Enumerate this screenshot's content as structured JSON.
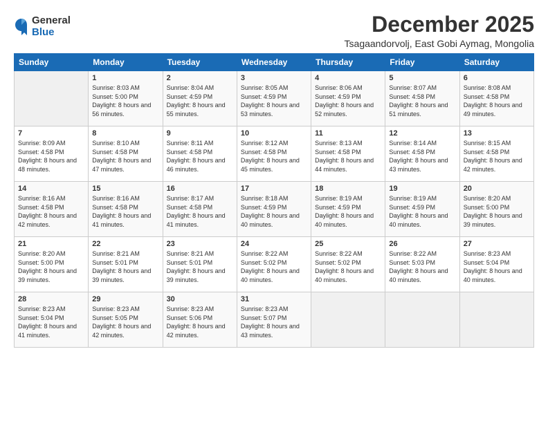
{
  "logo": {
    "general": "General",
    "blue": "Blue"
  },
  "title": "December 2025",
  "location": "Tsagaandorvolj, East Gobi Aymag, Mongolia",
  "days_of_week": [
    "Sunday",
    "Monday",
    "Tuesday",
    "Wednesday",
    "Thursday",
    "Friday",
    "Saturday"
  ],
  "weeks": [
    [
      {
        "day": "",
        "sunrise": "",
        "sunset": "",
        "daylight": ""
      },
      {
        "day": "1",
        "sunrise": "Sunrise: 8:03 AM",
        "sunset": "Sunset: 5:00 PM",
        "daylight": "Daylight: 8 hours and 56 minutes."
      },
      {
        "day": "2",
        "sunrise": "Sunrise: 8:04 AM",
        "sunset": "Sunset: 4:59 PM",
        "daylight": "Daylight: 8 hours and 55 minutes."
      },
      {
        "day": "3",
        "sunrise": "Sunrise: 8:05 AM",
        "sunset": "Sunset: 4:59 PM",
        "daylight": "Daylight: 8 hours and 53 minutes."
      },
      {
        "day": "4",
        "sunrise": "Sunrise: 8:06 AM",
        "sunset": "Sunset: 4:59 PM",
        "daylight": "Daylight: 8 hours and 52 minutes."
      },
      {
        "day": "5",
        "sunrise": "Sunrise: 8:07 AM",
        "sunset": "Sunset: 4:58 PM",
        "daylight": "Daylight: 8 hours and 51 minutes."
      },
      {
        "day": "6",
        "sunrise": "Sunrise: 8:08 AM",
        "sunset": "Sunset: 4:58 PM",
        "daylight": "Daylight: 8 hours and 49 minutes."
      }
    ],
    [
      {
        "day": "7",
        "sunrise": "Sunrise: 8:09 AM",
        "sunset": "Sunset: 4:58 PM",
        "daylight": "Daylight: 8 hours and 48 minutes."
      },
      {
        "day": "8",
        "sunrise": "Sunrise: 8:10 AM",
        "sunset": "Sunset: 4:58 PM",
        "daylight": "Daylight: 8 hours and 47 minutes."
      },
      {
        "day": "9",
        "sunrise": "Sunrise: 8:11 AM",
        "sunset": "Sunset: 4:58 PM",
        "daylight": "Daylight: 8 hours and 46 minutes."
      },
      {
        "day": "10",
        "sunrise": "Sunrise: 8:12 AM",
        "sunset": "Sunset: 4:58 PM",
        "daylight": "Daylight: 8 hours and 45 minutes."
      },
      {
        "day": "11",
        "sunrise": "Sunrise: 8:13 AM",
        "sunset": "Sunset: 4:58 PM",
        "daylight": "Daylight: 8 hours and 44 minutes."
      },
      {
        "day": "12",
        "sunrise": "Sunrise: 8:14 AM",
        "sunset": "Sunset: 4:58 PM",
        "daylight": "Daylight: 8 hours and 43 minutes."
      },
      {
        "day": "13",
        "sunrise": "Sunrise: 8:15 AM",
        "sunset": "Sunset: 4:58 PM",
        "daylight": "Daylight: 8 hours and 42 minutes."
      }
    ],
    [
      {
        "day": "14",
        "sunrise": "Sunrise: 8:16 AM",
        "sunset": "Sunset: 4:58 PM",
        "daylight": "Daylight: 8 hours and 42 minutes."
      },
      {
        "day": "15",
        "sunrise": "Sunrise: 8:16 AM",
        "sunset": "Sunset: 4:58 PM",
        "daylight": "Daylight: 8 hours and 41 minutes."
      },
      {
        "day": "16",
        "sunrise": "Sunrise: 8:17 AM",
        "sunset": "Sunset: 4:58 PM",
        "daylight": "Daylight: 8 hours and 41 minutes."
      },
      {
        "day": "17",
        "sunrise": "Sunrise: 8:18 AM",
        "sunset": "Sunset: 4:59 PM",
        "daylight": "Daylight: 8 hours and 40 minutes."
      },
      {
        "day": "18",
        "sunrise": "Sunrise: 8:19 AM",
        "sunset": "Sunset: 4:59 PM",
        "daylight": "Daylight: 8 hours and 40 minutes."
      },
      {
        "day": "19",
        "sunrise": "Sunrise: 8:19 AM",
        "sunset": "Sunset: 4:59 PM",
        "daylight": "Daylight: 8 hours and 40 minutes."
      },
      {
        "day": "20",
        "sunrise": "Sunrise: 8:20 AM",
        "sunset": "Sunset: 5:00 PM",
        "daylight": "Daylight: 8 hours and 39 minutes."
      }
    ],
    [
      {
        "day": "21",
        "sunrise": "Sunrise: 8:20 AM",
        "sunset": "Sunset: 5:00 PM",
        "daylight": "Daylight: 8 hours and 39 minutes."
      },
      {
        "day": "22",
        "sunrise": "Sunrise: 8:21 AM",
        "sunset": "Sunset: 5:01 PM",
        "daylight": "Daylight: 8 hours and 39 minutes."
      },
      {
        "day": "23",
        "sunrise": "Sunrise: 8:21 AM",
        "sunset": "Sunset: 5:01 PM",
        "daylight": "Daylight: 8 hours and 39 minutes."
      },
      {
        "day": "24",
        "sunrise": "Sunrise: 8:22 AM",
        "sunset": "Sunset: 5:02 PM",
        "daylight": "Daylight: 8 hours and 40 minutes."
      },
      {
        "day": "25",
        "sunrise": "Sunrise: 8:22 AM",
        "sunset": "Sunset: 5:02 PM",
        "daylight": "Daylight: 8 hours and 40 minutes."
      },
      {
        "day": "26",
        "sunrise": "Sunrise: 8:22 AM",
        "sunset": "Sunset: 5:03 PM",
        "daylight": "Daylight: 8 hours and 40 minutes."
      },
      {
        "day": "27",
        "sunrise": "Sunrise: 8:23 AM",
        "sunset": "Sunset: 5:04 PM",
        "daylight": "Daylight: 8 hours and 40 minutes."
      }
    ],
    [
      {
        "day": "28",
        "sunrise": "Sunrise: 8:23 AM",
        "sunset": "Sunset: 5:04 PM",
        "daylight": "Daylight: 8 hours and 41 minutes."
      },
      {
        "day": "29",
        "sunrise": "Sunrise: 8:23 AM",
        "sunset": "Sunset: 5:05 PM",
        "daylight": "Daylight: 8 hours and 42 minutes."
      },
      {
        "day": "30",
        "sunrise": "Sunrise: 8:23 AM",
        "sunset": "Sunset: 5:06 PM",
        "daylight": "Daylight: 8 hours and 42 minutes."
      },
      {
        "day": "31",
        "sunrise": "Sunrise: 8:23 AM",
        "sunset": "Sunset: 5:07 PM",
        "daylight": "Daylight: 8 hours and 43 minutes."
      },
      {
        "day": "",
        "sunrise": "",
        "sunset": "",
        "daylight": ""
      },
      {
        "day": "",
        "sunrise": "",
        "sunset": "",
        "daylight": ""
      },
      {
        "day": "",
        "sunrise": "",
        "sunset": "",
        "daylight": ""
      }
    ]
  ]
}
